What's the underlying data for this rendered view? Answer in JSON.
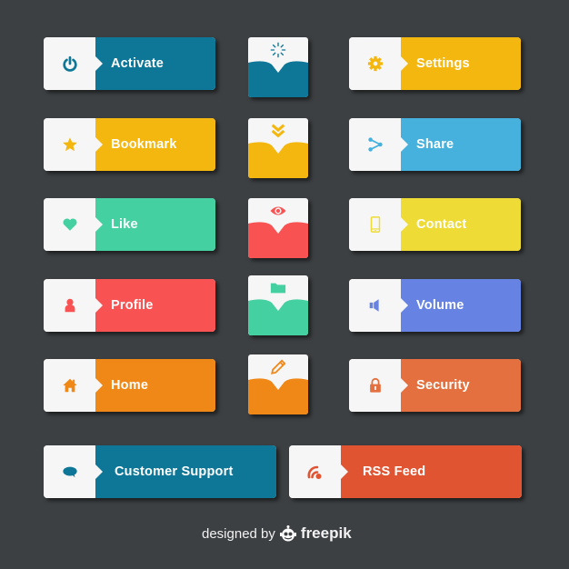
{
  "buttons": [
    {
      "label": "Activate",
      "icon": "power-icon",
      "color": "#0e7797"
    },
    {
      "label": "Bookmark",
      "icon": "star-icon",
      "color": "#f4b70f"
    },
    {
      "label": "Like",
      "icon": "heart-icon",
      "color": "#45d0a2"
    },
    {
      "label": "Profile",
      "icon": "user-icon",
      "color": "#f95252"
    },
    {
      "label": "Home",
      "icon": "home-icon",
      "color": "#f08817"
    },
    {
      "label": "Settings",
      "icon": "gear-icon",
      "color": "#f4b70f"
    },
    {
      "label": "Share",
      "icon": "share-icon",
      "color": "#46b1dd"
    },
    {
      "label": "Contact",
      "icon": "phone-icon",
      "color": "#eedb35"
    },
    {
      "label": "Volume",
      "icon": "speaker-icon",
      "color": "#6683e4"
    },
    {
      "label": "Security",
      "icon": "lock-icon",
      "color": "#e3703e"
    },
    {
      "label": "Customer Support",
      "icon": "chat-bubble-icon",
      "color": "#0e7797"
    },
    {
      "label": "RSS Feed",
      "icon": "rss-icon",
      "color": "#e05432"
    }
  ],
  "square_buttons": [
    {
      "icon": "loading-spinner-icon",
      "color": "#0e7797"
    },
    {
      "icon": "double-chevron-down-icon",
      "color": "#f4b70f"
    },
    {
      "icon": "eye-icon",
      "color": "#f95252"
    },
    {
      "icon": "folder-icon",
      "color": "#45d0a2"
    },
    {
      "icon": "pencil-icon",
      "color": "#f08817"
    }
  ],
  "footer": {
    "prefix": "designed by",
    "brand": "freepik"
  }
}
